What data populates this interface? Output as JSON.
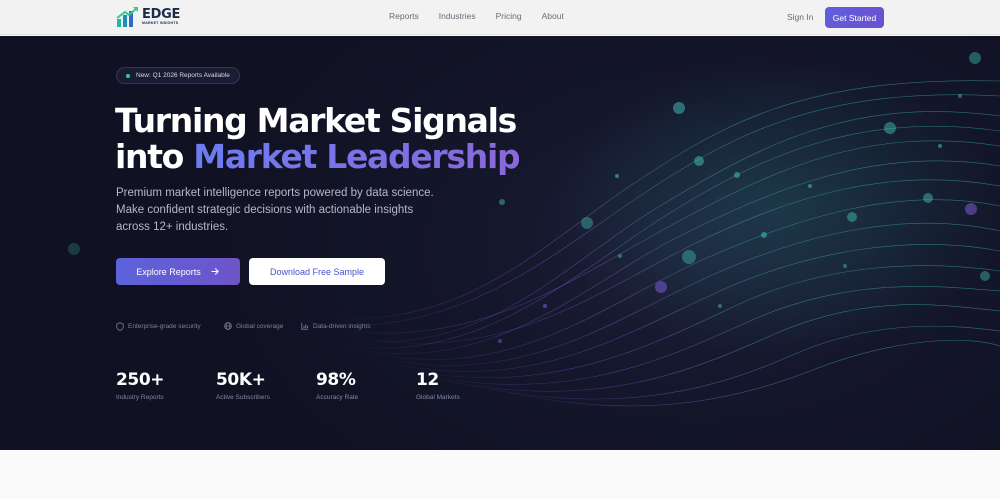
{
  "brand": {
    "name": "EDGE",
    "tagline": "MARKET INSIGHTS"
  },
  "nav": {
    "links": [
      "Reports",
      "Industries",
      "Pricing",
      "About"
    ],
    "signin": "Sign In",
    "cta": "Get Started"
  },
  "hero": {
    "badge": "New: Q1 2026 Reports Available",
    "headline_line1": "Turning Market Signals",
    "headline_line2_plain": "into",
    "headline_line2_accent": "Market Leadership",
    "subtitle": "Premium market intelligence reports powered by data science. Make confident strategic decisions with actionable insights across 12+ industries.",
    "primary_button": "Explore Reports",
    "secondary_button": "Download Free Sample",
    "trust": [
      "Enterprise-grade security",
      "Global coverage",
      "Data-driven insights"
    ],
    "stats": [
      {
        "value": "250+",
        "label": "Industry Reports"
      },
      {
        "value": "50K+",
        "label": "Active Subscribers"
      },
      {
        "value": "98%",
        "label": "Accuracy Rate"
      },
      {
        "value": "12",
        "label": "Global Markets"
      }
    ]
  },
  "colors": {
    "accent": "#5d60dd",
    "accent_gradient_end": "#8a68d8",
    "hero_background": "#14162b",
    "status_dot": "#22d3a6"
  },
  "icons": [
    "logo-icon",
    "arrow-right-icon",
    "shield-icon",
    "globe-icon",
    "bar-chart-icon"
  ]
}
